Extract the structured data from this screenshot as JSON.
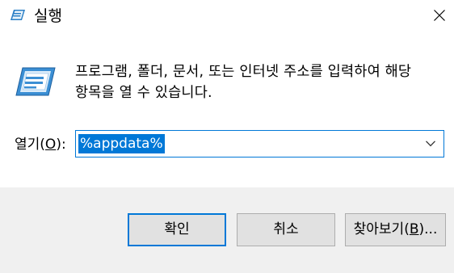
{
  "window": {
    "title": "실행",
    "icon": "run-dialog-icon",
    "close_icon": "close-icon"
  },
  "description": "프로그램, 폴더, 문서, 또는 인터넷 주소를 입력하여 해당\n항목을 열 수 있습니다.",
  "open_field": {
    "label_before": "열기(",
    "label_access_key": "O",
    "label_after": "):",
    "value": "%appdata%",
    "dropdown_icon": "chevron-down-icon"
  },
  "buttons": {
    "ok": "확인",
    "cancel": "취소",
    "browse_before": "찾아보기(",
    "browse_access_key": "B",
    "browse_after": ")..."
  },
  "colors": {
    "accent": "#0078d7",
    "footer_bg": "#f0f0f0",
    "button_bg": "#e1e1e1",
    "button_border": "#adadad"
  }
}
